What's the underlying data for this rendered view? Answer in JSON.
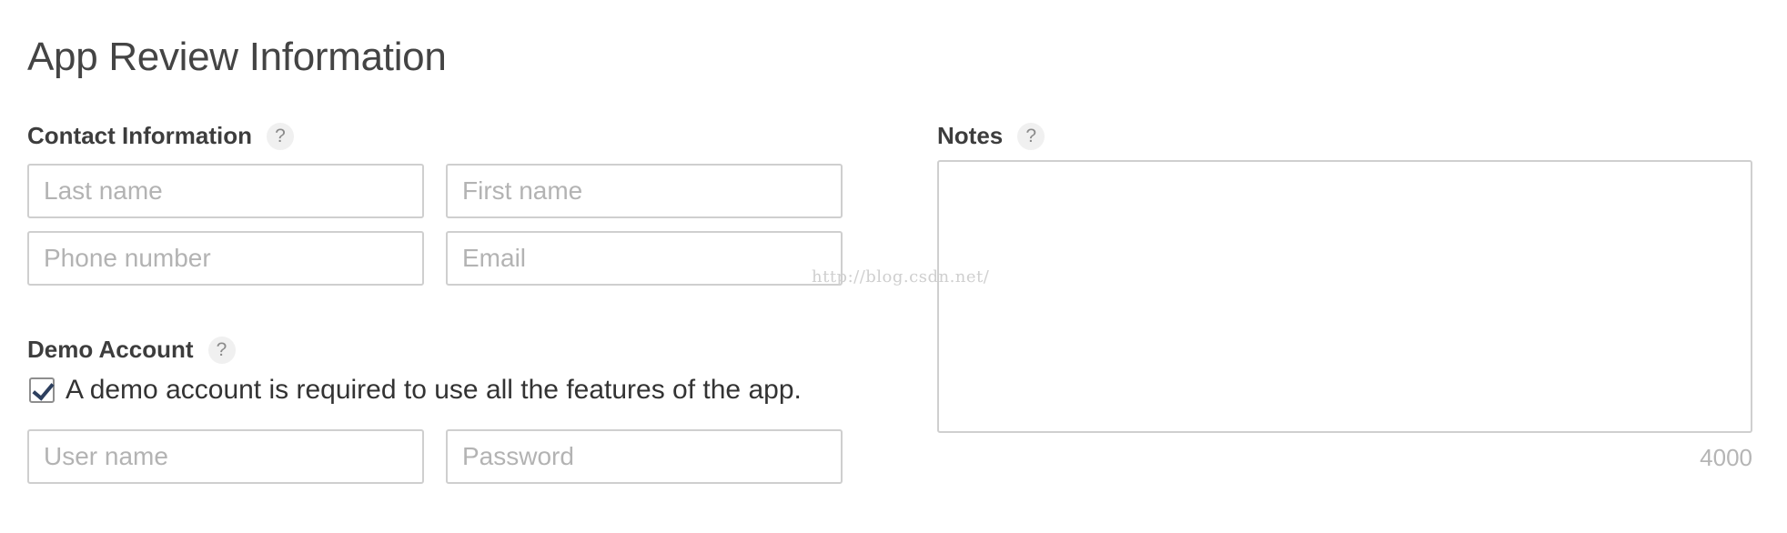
{
  "page": {
    "title": "App Review Information"
  },
  "contact": {
    "label": "Contact Information",
    "help": "?",
    "last_name_placeholder": "Last name",
    "first_name_placeholder": "First name",
    "phone_placeholder": "Phone number",
    "email_placeholder": "Email"
  },
  "demo": {
    "label": "Demo Account",
    "help": "?",
    "checkbox_label": "A demo account is required to use all the features of the app.",
    "checked": true,
    "username_placeholder": "User name",
    "password_placeholder": "Password"
  },
  "notes": {
    "label": "Notes",
    "help": "?",
    "char_count": "4000"
  },
  "watermark": "http://blog.csdn.net/",
  "icons": {
    "help": "question-mark-icon",
    "check": "checkmark-icon"
  },
  "colors": {
    "border": "#cfcfcf",
    "placeholder": "#b3b3b3",
    "check": "#2d3f5e"
  }
}
